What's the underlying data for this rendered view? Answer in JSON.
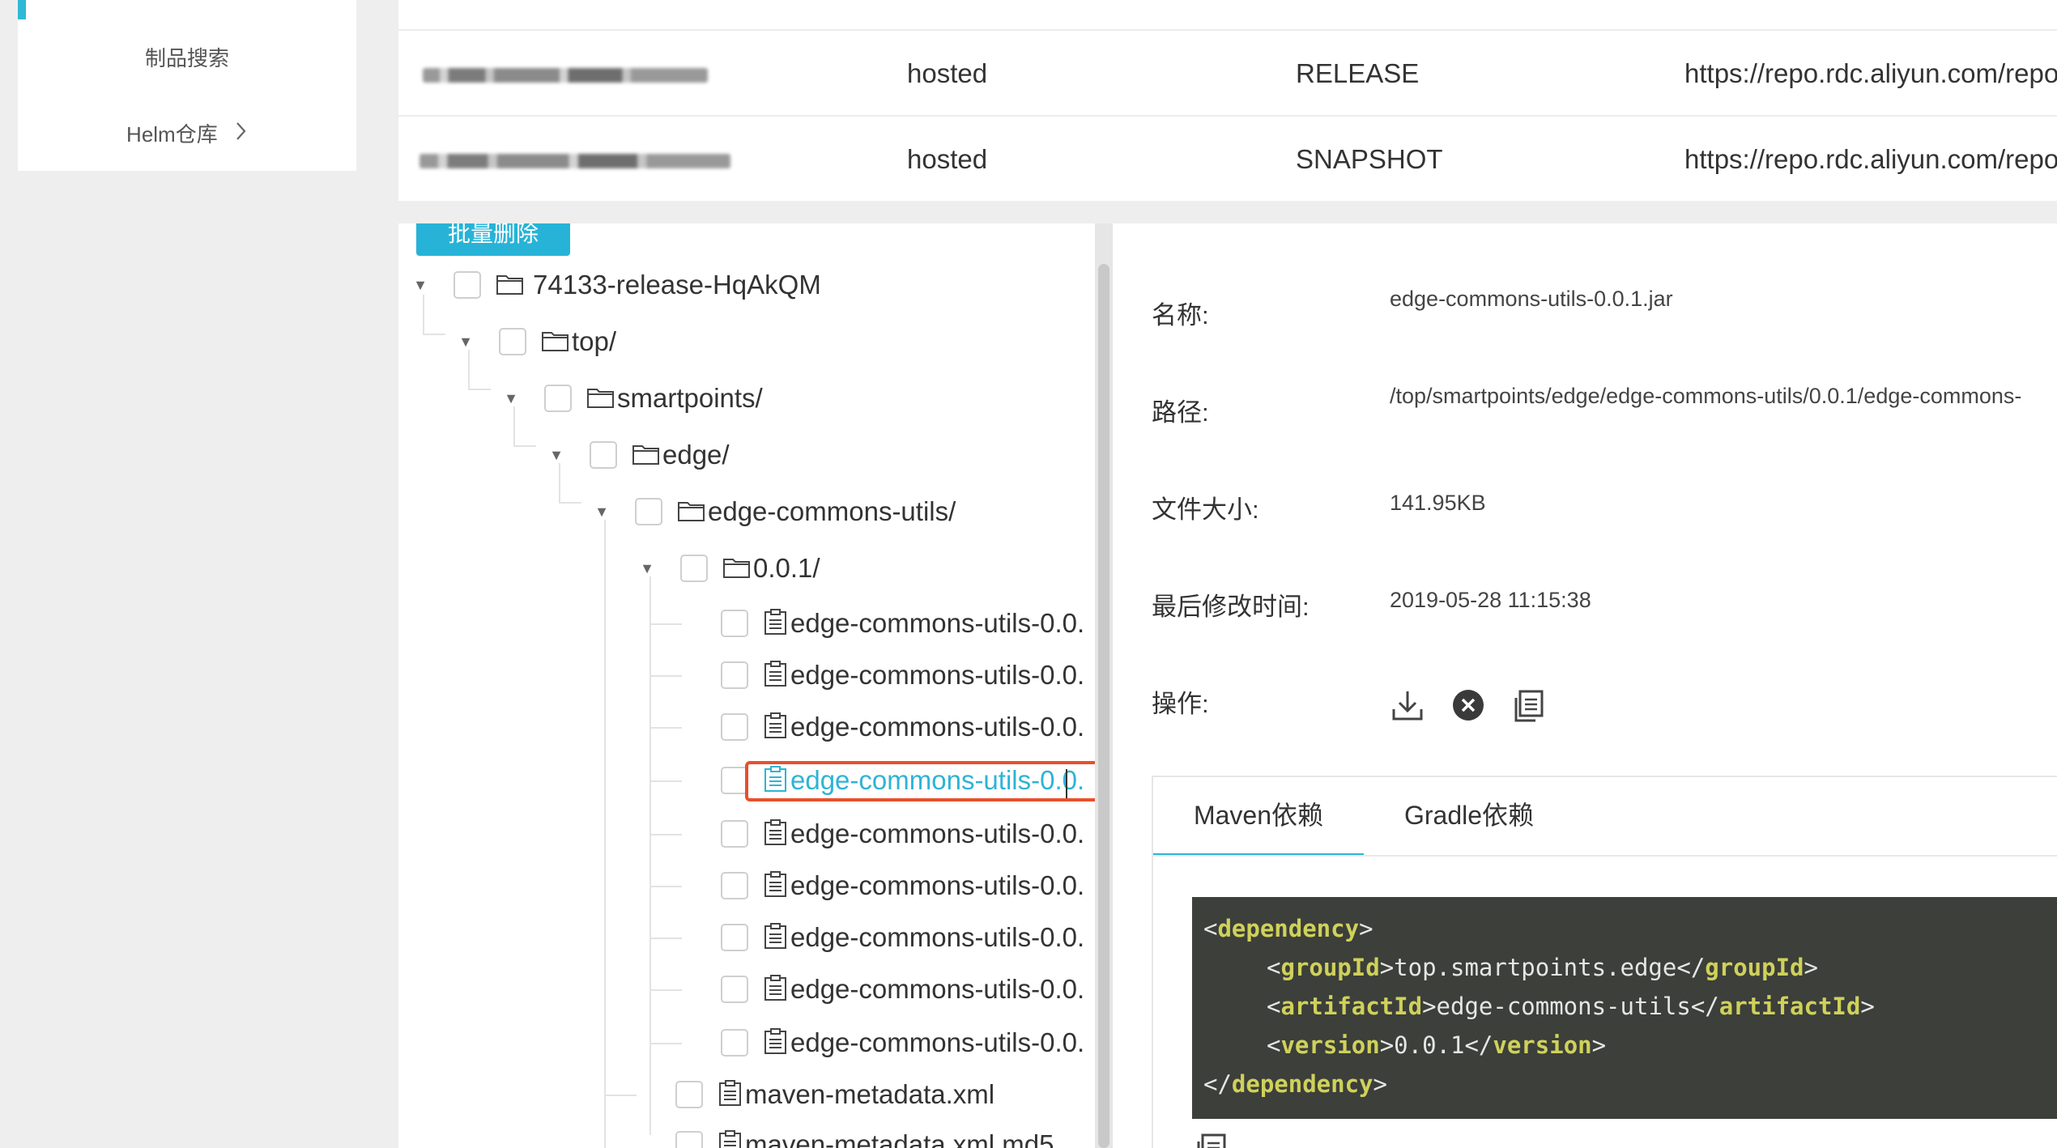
{
  "sidebar": {
    "items": [
      {
        "label": "制品搜索"
      },
      {
        "label": "Helm仓库",
        "chevron": "chevron-right-icon"
      }
    ],
    "accent_color": "#2fb8d6"
  },
  "repos": [
    {
      "name": "",
      "type": "hosted",
      "policy": "RELEASE",
      "url": "https://repo.rdc.aliyun.com/repo"
    },
    {
      "name": "",
      "type": "hosted",
      "policy": "SNAPSHOT",
      "url": "https://repo.rdc.aliyun.com/repo"
    }
  ],
  "tree": {
    "batch_delete_label": "批量删除",
    "nodes": [
      {
        "label": "74133-release-HqAkQM",
        "icon": "folder-icon"
      },
      {
        "label": "top/",
        "icon": "folder-icon"
      },
      {
        "label": "smartpoints/",
        "icon": "folder-icon"
      },
      {
        "label": "edge/",
        "icon": "folder-icon"
      },
      {
        "label": "edge-commons-utils/",
        "icon": "folder-icon"
      },
      {
        "label": "0.0.1/",
        "icon": "folder-icon"
      },
      {
        "label": "edge-commons-utils-0.0.",
        "icon": "file-icon"
      },
      {
        "label": "edge-commons-utils-0.0.",
        "icon": "file-icon"
      },
      {
        "label": "edge-commons-utils-0.0.",
        "icon": "file-icon"
      },
      {
        "label": "edge-commons-utils-0.0.",
        "icon": "file-icon",
        "selected": true
      },
      {
        "label": "edge-commons-utils-0.0.",
        "icon": "file-icon"
      },
      {
        "label": "edge-commons-utils-0.0.",
        "icon": "file-icon"
      },
      {
        "label": "edge-commons-utils-0.0.",
        "icon": "file-icon"
      },
      {
        "label": "edge-commons-utils-0.0.",
        "icon": "file-icon"
      },
      {
        "label": "edge-commons-utils-0.0.",
        "icon": "file-icon"
      },
      {
        "label": "maven-metadata.xml",
        "icon": "file-icon"
      },
      {
        "label": "maven-metadata.xml.md5",
        "icon": "file-icon"
      }
    ],
    "selected_color": "#2fb3d6",
    "highlight_color": "#e8502c"
  },
  "detail": {
    "name_label": "名称:",
    "name_value": "edge-commons-utils-0.0.1.jar",
    "path_label": "路径:",
    "path_value": "/top/smartpoints/edge/edge-commons-utils/0.0.1/edge-commons-",
    "size_label": "文件大小:",
    "size_value": "141.95KB",
    "modified_label": "最后修改时间:",
    "modified_value": "2019-05-28 11:15:38",
    "actions_label": "操作:",
    "actions": [
      "download-icon",
      "delete-icon",
      "copy-icon"
    ],
    "tabs": [
      {
        "label": "Maven依赖",
        "active": true
      },
      {
        "label": "Gradle依赖",
        "active": false
      }
    ],
    "code": {
      "open_dependency": "dependency",
      "group_tag": "groupId",
      "group_value": "top.smartpoints.edge",
      "artifact_tag": "artifactId",
      "artifact_value": "edge-commons-utils",
      "version_tag": "version",
      "version_value": "0.0.1"
    }
  }
}
